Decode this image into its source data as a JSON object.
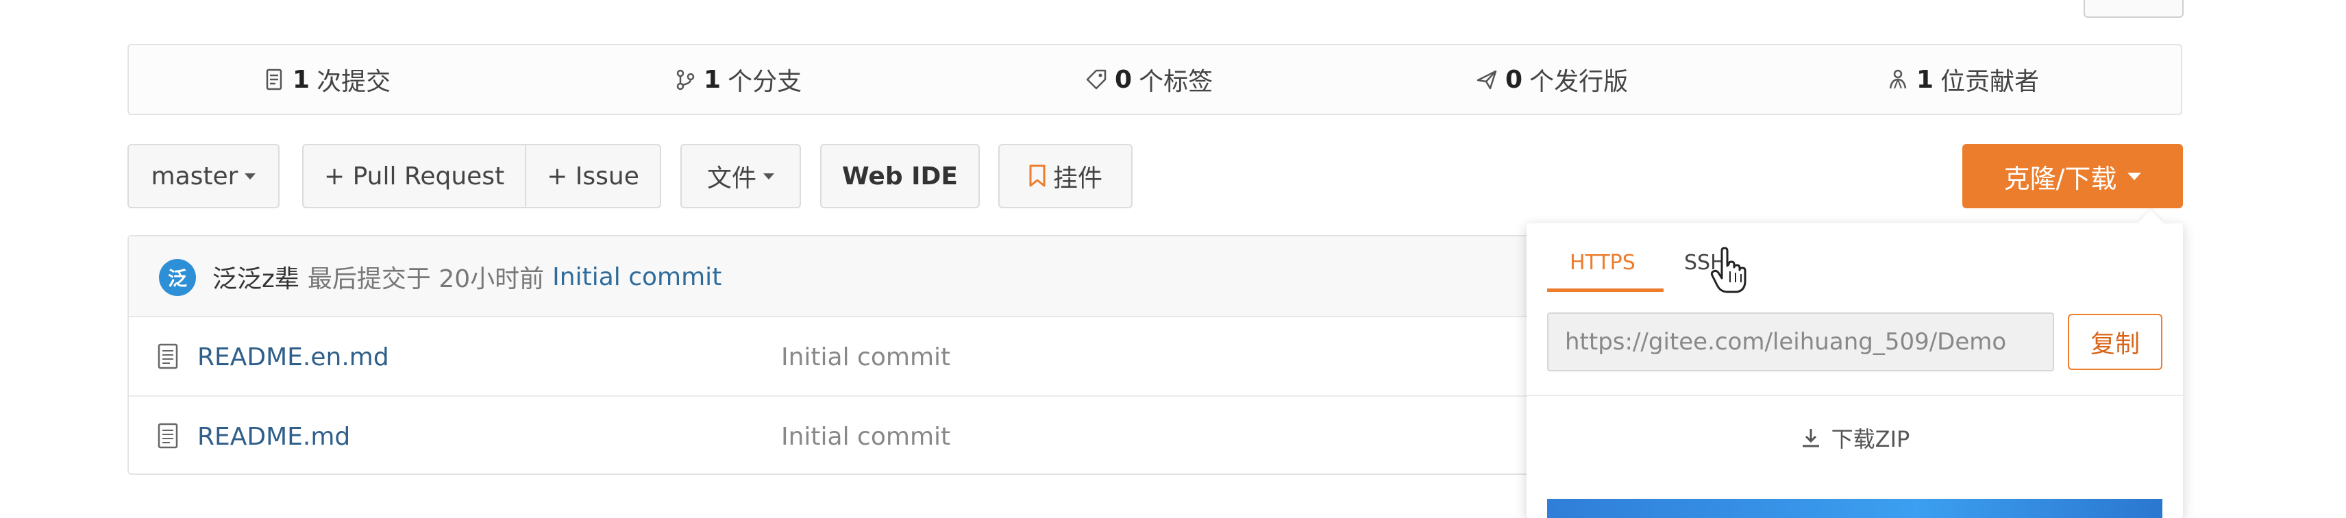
{
  "stats": {
    "commits": {
      "count": "1",
      "label": "次提交",
      "icon": "commit-icon"
    },
    "branches": {
      "count": "1",
      "label": "个分支",
      "icon": "branch-icon"
    },
    "tags": {
      "count": "0",
      "label": "个标签",
      "icon": "tag-icon"
    },
    "releases": {
      "count": "0",
      "label": "个发行版",
      "icon": "release-icon"
    },
    "contributors": {
      "count": "1",
      "label": "位贡献者",
      "icon": "contributors-icon"
    }
  },
  "toolbar": {
    "branch": "master",
    "pull_request": "+ Pull Request",
    "issue": "+ Issue",
    "file": "文件",
    "web_ide": "Web IDE",
    "widget": "挂件",
    "clone": "克隆/下载"
  },
  "last_commit": {
    "avatar": "泛",
    "author": "泛泛z辈",
    "meta": "最后提交于 20小时前",
    "message": "Initial commit"
  },
  "files": [
    {
      "name": "README.en.md",
      "commit": "Initial commit"
    },
    {
      "name": "README.md",
      "commit": "Initial commit"
    }
  ],
  "clone_dropdown": {
    "tab_https": "HTTPS",
    "tab_ssh": "SSH",
    "url": "https://gitee.com/leihuang_509/Demo",
    "copy": "复制",
    "download_zip": "下载ZIP"
  },
  "colors": {
    "accent": "#ec7d2c",
    "link": "#2f6b9a",
    "avatar": "#2d8fd5"
  }
}
